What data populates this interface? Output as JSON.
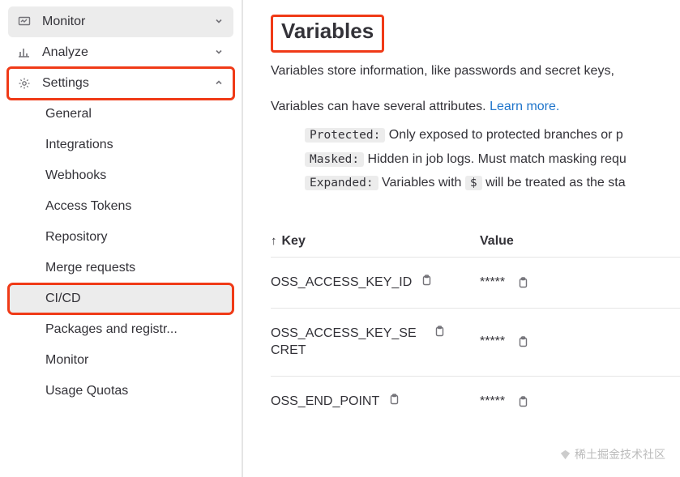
{
  "sidebar": {
    "monitor": {
      "label": "Monitor"
    },
    "analyze": {
      "label": "Analyze"
    },
    "settings": {
      "label": "Settings",
      "items": [
        {
          "label": "General"
        },
        {
          "label": "Integrations"
        },
        {
          "label": "Webhooks"
        },
        {
          "label": "Access Tokens"
        },
        {
          "label": "Repository"
        },
        {
          "label": "Merge requests"
        },
        {
          "label": "CI/CD"
        },
        {
          "label": "Packages and registr..."
        },
        {
          "label": "Monitor"
        },
        {
          "label": "Usage Quotas"
        }
      ]
    }
  },
  "main": {
    "title": "Variables",
    "desc": "Variables store information, like passwords and secret keys,",
    "attr_line_pre": "Variables can have several attributes. ",
    "learn_more": "Learn more.",
    "bullets": {
      "protected": {
        "code": "Protected:",
        "text": " Only exposed to protected branches or p"
      },
      "masked": {
        "code": "Masked:",
        "text": " Hidden in job logs. Must match masking requ"
      },
      "expanded": {
        "code": "Expanded:",
        "pre": " Variables with ",
        "dollar": "$",
        "post": " will be treated as the sta"
      }
    },
    "table": {
      "key_header": "Key",
      "value_header": "Value",
      "rows": [
        {
          "key": "OSS_ACCESS_KEY_ID",
          "value": "*****"
        },
        {
          "key": "OSS_ACCESS_KEY_SECRET",
          "value": "*****"
        },
        {
          "key": "OSS_END_POINT",
          "value": "*****"
        }
      ]
    }
  },
  "watermark": "稀土掘金技术社区"
}
